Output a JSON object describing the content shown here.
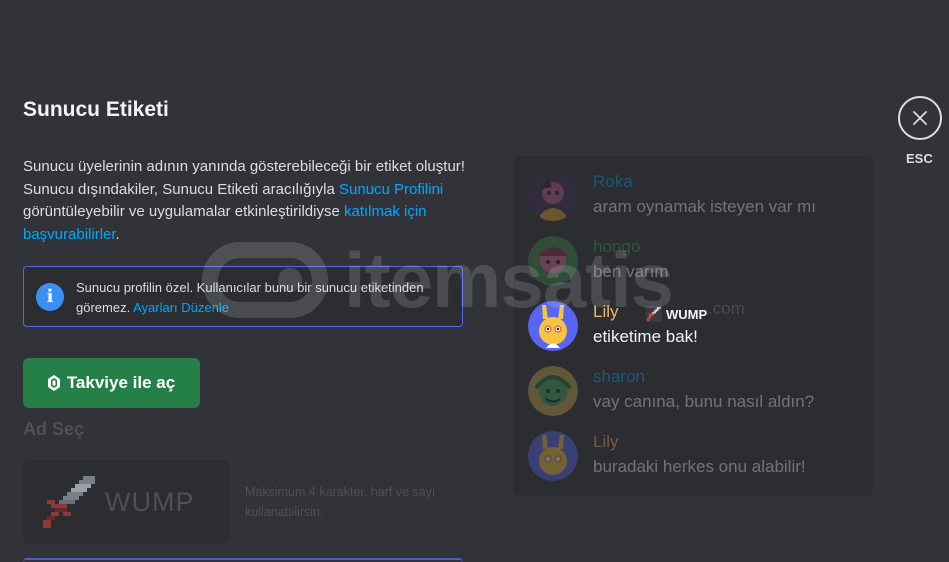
{
  "modal": {
    "title": "Sunucu Etiketi",
    "description": {
      "part1": "Sunucu üyelerinin adının yanında gösterebileceği bir etiket oluştur! Sunucu dışındakiler, Sunucu Etiketi aracılığıyla ",
      "link1": "Sunucu Profilini",
      "part2": " görüntüleyebilir ve uygulamalar etkinleştirildiyse ",
      "link2": "katılmak için başvurabilirler",
      "part3": "."
    },
    "notice": {
      "icon": "info-icon",
      "text": "Sunucu profilin özel. Kullanıcılar bunu bir sunucu etiketinden göremez. ",
      "link": "Ayarları Düzenle"
    },
    "boost_button": {
      "label": "Takviye ile aç",
      "icon": "boost-gem-icon"
    },
    "name_section": {
      "label": "Ad Seç",
      "preview_tag": "WUMP",
      "preview_icon": "sword-icon",
      "hint": "Maksimum 4 karakter, harf ve sayı kullanabilirsin."
    }
  },
  "chat_preview": {
    "messages": [
      {
        "author": "Roka",
        "author_color": "#00a8fc",
        "text": "aram oynamak isteyen var mı",
        "avatar_color": "#3b2a55"
      },
      {
        "author": "hongo",
        "author_color": "#3ba55c",
        "text": "ben varım",
        "avatar_color": "#3e8a48"
      },
      {
        "author": "Lily",
        "author_color": "#f0b36a",
        "text": "etiketime bak!",
        "tag": "WUMP",
        "tag_icon": "sword-icon",
        "avatar_color": "#5865f2"
      },
      {
        "author": "sharon",
        "author_color": "#00a8fc",
        "text": "vay canına, bunu nasıl aldın?",
        "avatar_color": "#c9a74a"
      },
      {
        "author": "Lily",
        "author_color": "#f0b36a",
        "text": "buradaki herkes onu alabilir!",
        "avatar_color": "#5865f2"
      }
    ]
  },
  "close": {
    "label": "ESC",
    "icon": "close-icon"
  },
  "watermark": {
    "text": "itemsatis",
    "suffix": ".com"
  },
  "colors": {
    "accent": "#5865f2",
    "link": "#00a8fc",
    "boost_green": "#248046",
    "background": "#313338"
  }
}
